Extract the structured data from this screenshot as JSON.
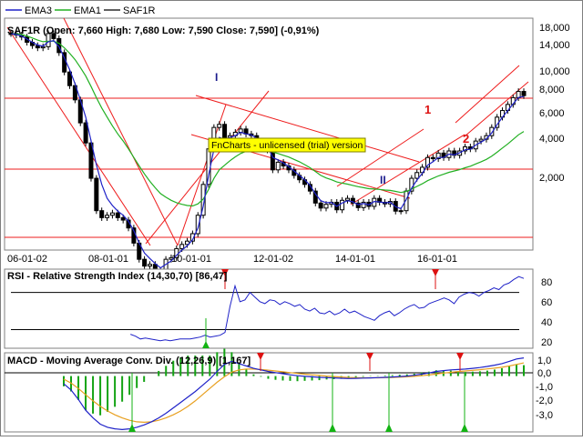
{
  "legend": [
    {
      "name": "EMA3",
      "color": "#1f22c8"
    },
    {
      "name": "EMA1",
      "color": "#22b022"
    },
    {
      "name": "SAF1R",
      "color": "#000000"
    }
  ],
  "price_header": "SAF1R (Open: 7,660  High: 7,680  Low: 7,590  Close: 7,590] (-0,91%)",
  "watermark": "FnCharts - unlicensed (trial) version",
  "wave_labels": {
    "I": "I",
    "II": "II",
    "one": "1",
    "two": "2"
  },
  "x_ticks": [
    "06-01-02",
    "08-01-01",
    "10-01-01",
    "12-01-02",
    "14-01-01",
    "16-01-01"
  ],
  "price_axis": [
    "18,000",
    "14,000",
    "10,000",
    "8,000",
    "6,000",
    "4,000",
    "2,000"
  ],
  "rsi_title": "RSI - Relative Strength Index (14,30,70) [86,47]",
  "rsi_axis": [
    "80",
    "60",
    "40",
    "20"
  ],
  "macd_title": "MACD - Moving Average Conv. Div. (12,26,9) [1,167]",
  "macd_axis": [
    "1,0",
    "0,0",
    "-1,0",
    "-2,0",
    "-3,0"
  ],
  "colors": {
    "border": "#7f7f7f",
    "channel": "#ee1c1c",
    "candle": "#000000",
    "ema_fast": "#1f22c8",
    "ema_slow": "#22b022",
    "macd_line": "#1f22c8",
    "signal_line": "#e8a020",
    "hist_pos": "#13a313",
    "marker_up": "#13b313",
    "marker_down": "#dd1111",
    "watermark_bg": "#ffff00"
  },
  "chart_data": {
    "type": "line",
    "price": {
      "scale": "log",
      "ylim": [
        1100,
        20000
      ],
      "close": [
        16500,
        16200,
        15800,
        14800,
        14200,
        13800,
        14000,
        16500,
        15500,
        13000,
        10200,
        8600,
        7200,
        5400,
        4200,
        2700,
        1800,
        1650,
        1700,
        1750,
        1650,
        1600,
        1450,
        1200,
        980,
        900,
        920,
        850,
        820,
        980,
        1000,
        1120,
        1180,
        1230,
        1350,
        1700,
        2500,
        3900,
        5100,
        5300,
        4300,
        4600,
        4800,
        5000,
        4700,
        4600,
        4300,
        4200,
        3850,
        3000,
        3300,
        3150,
        3000,
        2800,
        2650,
        2500,
        2300,
        1980,
        1860,
        1950,
        2000,
        1820,
        2050,
        2100,
        1980,
        1870,
        2000,
        1900,
        2100,
        2000,
        1960,
        2020,
        1790,
        1800,
        2300,
        2700,
        2900,
        3100,
        3500,
        3450,
        3700,
        3500,
        3800,
        3600,
        3800,
        4000,
        3900,
        4300,
        4400,
        4600,
        5100,
        5800,
        6300,
        6800,
        7400,
        8000,
        7590
      ],
      "ema_fast": [
        16500,
        16300,
        16000,
        15400,
        14800,
        14300,
        14100,
        14900,
        15100,
        14000,
        12200,
        10500,
        8800,
        7200,
        5800,
        4300,
        3200,
        2500,
        2100,
        1920,
        1790,
        1700,
        1580,
        1400,
        1200,
        1060,
        990,
        930,
        880,
        920,
        960,
        1030,
        1100,
        1160,
        1250,
        1450,
        1900,
        2800,
        3900,
        4500,
        4400,
        4500,
        4600,
        4800,
        4700,
        4650,
        4450,
        4300,
        4050,
        3500,
        3400,
        3270,
        3130,
        2960,
        2800,
        2650,
        2470,
        2220,
        2040,
        1990,
        1995,
        1900,
        1980,
        2040,
        2010,
        1940,
        1970,
        1935,
        2020,
        2010,
        1985,
        2000,
        1890,
        1845,
        2070,
        2380,
        2640,
        2870,
        3180,
        3320,
        3500,
        3500,
        3650,
        3625,
        3710,
        3855,
        3880,
        4090,
        4245,
        4420,
        4760,
        5280,
        5790,
        6300,
        6850,
        7420,
        7500
      ],
      "ema_slow": [
        16500,
        16450,
        16300,
        16000,
        15600,
        15200,
        14900,
        15000,
        15000,
        14600,
        13800,
        12900,
        11900,
        10800,
        9700,
        8500,
        7400,
        6500,
        5800,
        5200,
        4700,
        4300,
        3900,
        3500,
        3150,
        2850,
        2600,
        2400,
        2230,
        2130,
        2050,
        1990,
        1950,
        1920,
        1910,
        1960,
        2080,
        2350,
        2700,
        3000,
        3180,
        3360,
        3530,
        3680,
        3780,
        3850,
        3880,
        3890,
        3870,
        3750,
        3680,
        3600,
        3520,
        3420,
        3320,
        3200,
        3080,
        2940,
        2800,
        2710,
        2650,
        2580,
        2540,
        2510,
        2470,
        2430,
        2400,
        2370,
        2360,
        2350,
        2330,
        2320,
        2290,
        2260,
        2290,
        2360,
        2440,
        2520,
        2620,
        2700,
        2780,
        2840,
        2910,
        2960,
        3010,
        3080,
        3140,
        3230,
        3320,
        3420,
        3560,
        3740,
        3940,
        4150,
        4390,
        4650,
        4850
      ]
    },
    "rsi": {
      "ylim": [
        10,
        95
      ],
      "levels": [
        30,
        70
      ],
      "values": [
        null,
        null,
        null,
        null,
        null,
        null,
        null,
        null,
        null,
        null,
        null,
        null,
        null,
        null,
        null,
        null,
        null,
        null,
        null,
        null,
        null,
        null,
        null,
        null,
        25,
        23,
        20,
        21,
        20,
        19,
        18,
        19,
        18,
        19,
        20,
        20,
        20,
        21,
        22,
        24,
        22,
        23,
        24,
        27,
        55,
        77,
        60,
        62,
        70,
        65,
        60,
        58,
        62,
        61,
        57,
        60,
        58,
        55,
        57,
        52,
        50,
        53,
        48,
        47,
        50,
        46,
        48,
        52,
        48,
        50,
        47,
        44,
        42,
        40,
        45,
        48,
        50,
        45,
        48,
        52,
        55,
        57,
        53,
        54,
        58,
        60,
        62,
        64,
        62,
        58,
        65,
        68,
        70,
        69,
        66,
        70,
        72,
        75,
        73,
        78,
        80,
        84,
        87,
        85
      ]
    },
    "macd": {
      "ylim": [
        -3.6,
        1.5
      ],
      "macd": [
        -0.5,
        -0.9,
        -1.5,
        -2.2,
        -2.7,
        -3.1,
        -3.3,
        -3.4,
        -3.45,
        -3.4,
        -3.3,
        -3.15,
        -2.95,
        -2.7,
        -2.4,
        -2.05,
        -1.7,
        -1.35,
        -1.0,
        -0.6,
        -0.2,
        0.3,
        0.75,
        0.95,
        0.8,
        0.65,
        0.5,
        0.4,
        0.3,
        0.22,
        0.15,
        0.08,
        0.02,
        -0.02,
        -0.05,
        -0.08,
        -0.1,
        -0.12,
        -0.14,
        -0.16,
        -0.15,
        -0.13,
        -0.12,
        -0.1,
        -0.08,
        -0.06,
        -0.03,
        0.0,
        0.05,
        0.12,
        0.2,
        0.3,
        0.35,
        0.4,
        0.42,
        0.45,
        0.5,
        0.55,
        0.62,
        0.7,
        0.8,
        0.95,
        1.1,
        1.17
      ],
      "signal": [
        -0.2,
        -0.45,
        -0.8,
        -1.2,
        -1.6,
        -1.95,
        -2.25,
        -2.5,
        -2.7,
        -2.85,
        -2.95,
        -2.98,
        -2.95,
        -2.85,
        -2.7,
        -2.5,
        -2.25,
        -1.95,
        -1.6,
        -1.2,
        -0.8,
        -0.4,
        -0.05,
        0.25,
        0.4,
        0.45,
        0.45,
        0.42,
        0.38,
        0.33,
        0.28,
        0.22,
        0.17,
        0.12,
        0.08,
        0.04,
        0.0,
        -0.03,
        -0.06,
        -0.09,
        -0.1,
        -0.11,
        -0.11,
        -0.11,
        -0.1,
        -0.09,
        -0.07,
        -0.05,
        -0.02,
        0.02,
        0.07,
        0.13,
        0.19,
        0.24,
        0.29,
        0.33,
        0.37,
        0.41,
        0.46,
        0.51,
        0.57,
        0.65,
        0.75,
        0.85
      ],
      "histogram": [
        -0.3,
        -0.45,
        -0.7,
        -1.0,
        -1.1,
        -1.15,
        -1.05,
        -0.9,
        -0.75,
        -0.55,
        -0.35,
        -0.17,
        0.0,
        0.15,
        0.3,
        0.45,
        0.55,
        0.6,
        0.6,
        0.6,
        0.6,
        0.7,
        0.8,
        0.7,
        0.4,
        0.2,
        0.05,
        -0.02,
        -0.08,
        -0.11,
        -0.13,
        -0.14,
        -0.15,
        -0.14,
        -0.13,
        -0.12,
        -0.1,
        -0.09,
        -0.08,
        -0.07,
        -0.05,
        -0.02,
        -0.01,
        0.01,
        0.02,
        0.03,
        0.04,
        0.05,
        0.07,
        0.1,
        0.13,
        0.17,
        0.16,
        0.16,
        0.13,
        0.12,
        0.13,
        0.14,
        0.16,
        0.19,
        0.23,
        0.3,
        0.35,
        0.32
      ]
    }
  }
}
